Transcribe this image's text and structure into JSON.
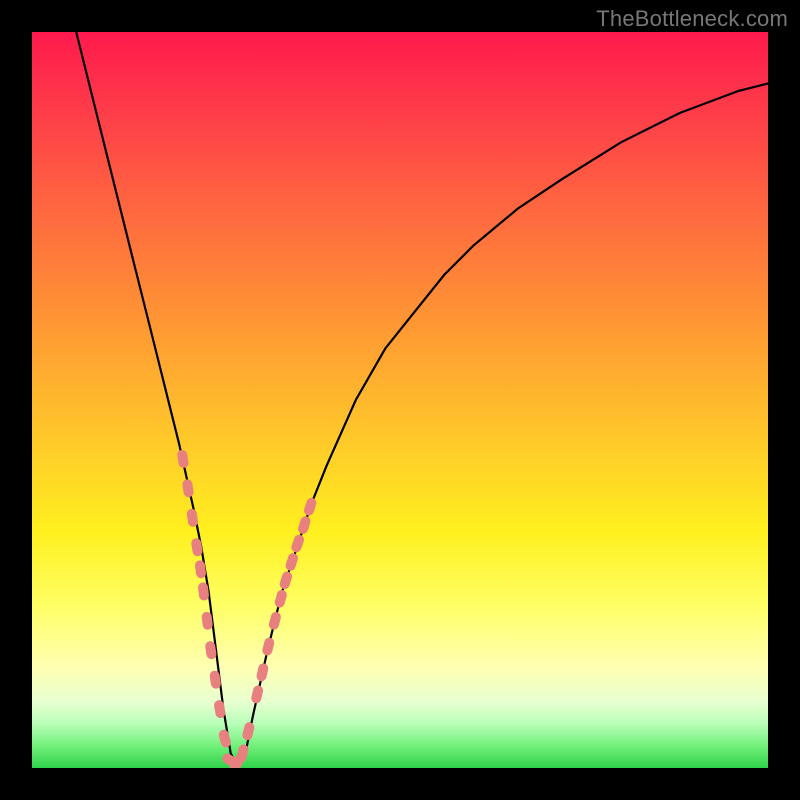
{
  "watermark": "TheBottleneck.com",
  "colors": {
    "frame": "#000000",
    "gradient_top": "#ff1a4d",
    "gradient_bottom": "#2fd24a",
    "curve": "#000000",
    "marker": "#e88080"
  },
  "chart_data": {
    "type": "line",
    "title": "",
    "xlabel": "",
    "ylabel": "",
    "xlim": [
      0,
      100
    ],
    "ylim": [
      0,
      100
    ],
    "series": [
      {
        "name": "bottleneck-curve",
        "x": [
          6,
          8,
          10,
          12,
          14,
          16,
          18,
          20,
          22,
          23,
          24,
          25,
          26,
          27,
          28,
          29,
          30,
          32,
          34,
          36,
          38,
          40,
          44,
          48,
          52,
          56,
          60,
          66,
          72,
          80,
          88,
          96,
          100
        ],
        "y": [
          100,
          92,
          84,
          76,
          68,
          60,
          52,
          44,
          35,
          30,
          24,
          16,
          8,
          2,
          0,
          2,
          7,
          16,
          24,
          30,
          36,
          41,
          50,
          57,
          62,
          67,
          71,
          76,
          80,
          85,
          89,
          92,
          93
        ]
      }
    ],
    "markers": {
      "name": "highlighted-points",
      "points_xy": [
        [
          20.5,
          42
        ],
        [
          21.2,
          38
        ],
        [
          21.8,
          34
        ],
        [
          22.4,
          30
        ],
        [
          22.9,
          27
        ],
        [
          23.3,
          24
        ],
        [
          23.8,
          20
        ],
        [
          24.3,
          16
        ],
        [
          24.9,
          12
        ],
        [
          25.5,
          8
        ],
        [
          26.2,
          4
        ],
        [
          27.0,
          1
        ],
        [
          27.8,
          0.5
        ],
        [
          28.6,
          2
        ],
        [
          29.4,
          5
        ],
        [
          30.6,
          10
        ],
        [
          31.3,
          13
        ],
        [
          32.1,
          16.5
        ],
        [
          33.0,
          20
        ],
        [
          33.8,
          23
        ],
        [
          34.5,
          25.5
        ],
        [
          35.3,
          28
        ],
        [
          36.1,
          30.5
        ],
        [
          37.0,
          33
        ],
        [
          37.8,
          35.5
        ]
      ]
    }
  }
}
